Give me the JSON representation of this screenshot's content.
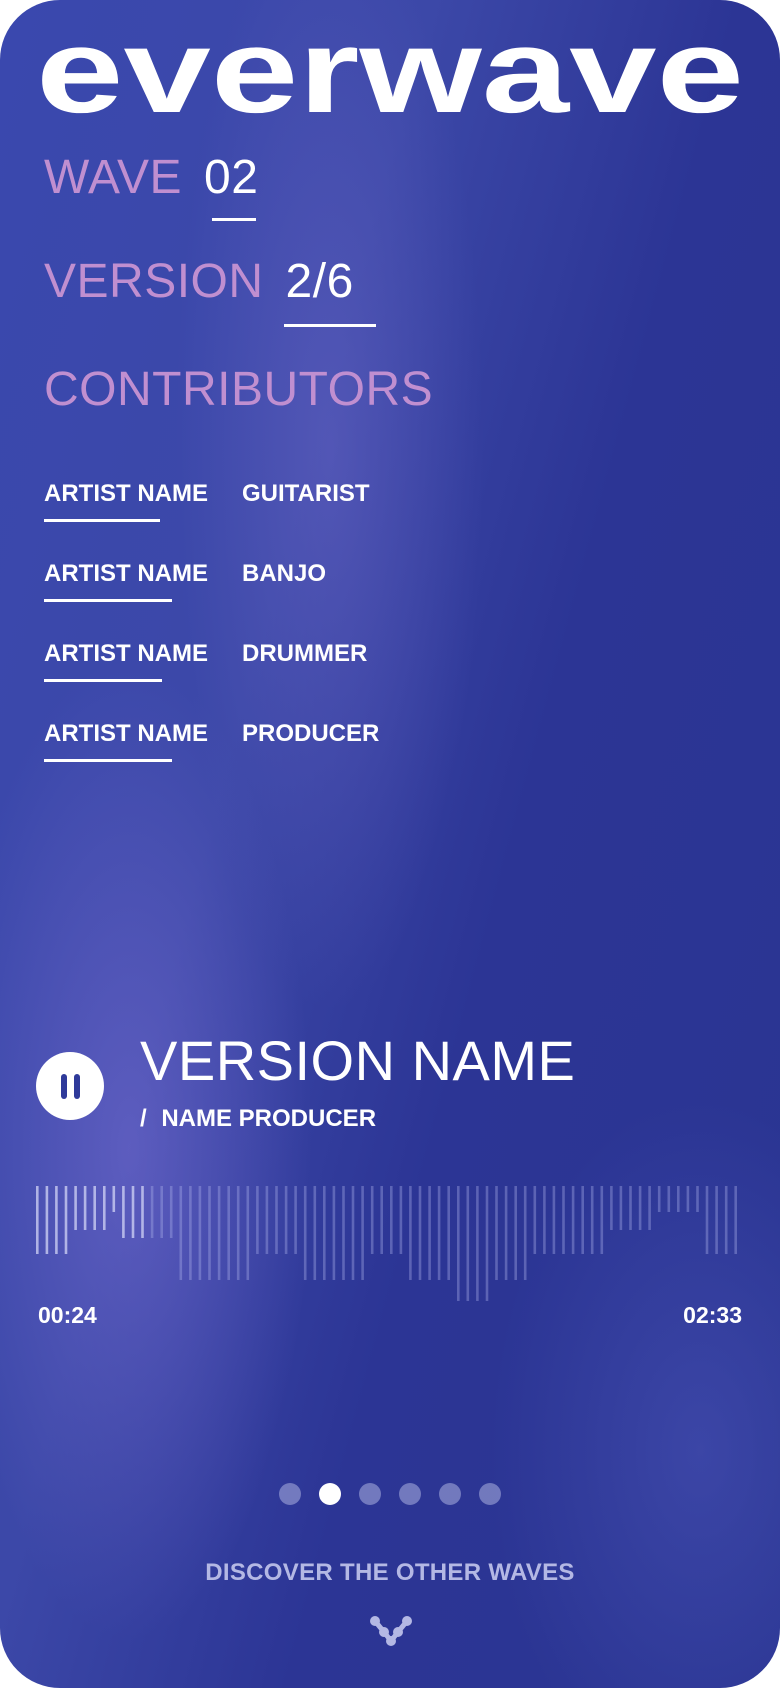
{
  "brand": {
    "logo_text": "everwave"
  },
  "wave": {
    "label": "WAVE",
    "value": "02"
  },
  "version": {
    "label": "VERSION",
    "value": "2/6"
  },
  "contributors": {
    "heading": "CONTRIBUTORS",
    "items": [
      {
        "name": "ARTIST NAME",
        "role": "GUITARIST"
      },
      {
        "name": "ARTIST NAME",
        "role": "BANJO"
      },
      {
        "name": "ARTIST NAME",
        "role": "DRUMMER"
      },
      {
        "name": "ARTIST NAME",
        "role": "PRODUCER"
      }
    ]
  },
  "player": {
    "title": "VERSION NAME",
    "subtitle_prefix": "/",
    "subtitle": "NAME PRODUCER",
    "elapsed": "00:24",
    "duration": "02:33",
    "state_icon": "pause-icon",
    "progress": 0.16
  },
  "pager": {
    "count": 6,
    "active_index": 1
  },
  "footer": {
    "discover_label": "DISCOVER THE OTHER WAVES",
    "icon": "wave-mark-icon"
  },
  "colors": {
    "background": "#2f3a9a",
    "label": "#c08fd0",
    "text": "#ffffff",
    "muted_text": "#b4b8e4"
  }
}
